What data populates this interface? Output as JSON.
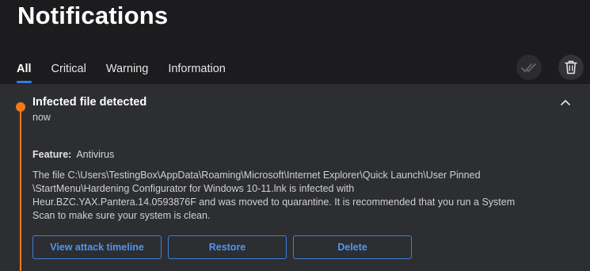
{
  "header": {
    "title": "Notifications"
  },
  "tabs": [
    {
      "label": "All",
      "active": true
    },
    {
      "label": "Critical",
      "active": false
    },
    {
      "label": "Warning",
      "active": false
    },
    {
      "label": "Information",
      "active": false
    }
  ],
  "toolbar": {
    "mark_all_icon": "double-check-icon",
    "delete_all_icon": "trash-icon"
  },
  "notification": {
    "title": "Infected file detected",
    "time": "now",
    "severity_color": "#f07b1c",
    "feature_label": "Feature:",
    "feature_value": "Antivirus",
    "description": "The file C:\\Users\\TestingBox\\AppData\\Roaming\\Microsoft\\Internet Explorer\\Quick Launch\\User Pinned\n\\StartMenu\\Hardening Configurator for Windows 10-11.lnk is infected with\nHeur.BZC.YAX.Pantera.14.0593876F and was moved to quarantine. It is recommended that you run a System\nScan to make sure your system is clean.",
    "actions": {
      "view_timeline": "View attack timeline",
      "restore": "Restore",
      "delete": "Delete"
    }
  },
  "colors": {
    "accent": "#2f7de1",
    "button_text": "#4f95f0",
    "background": "#1c1c1f",
    "panel": "#2d2e32"
  }
}
